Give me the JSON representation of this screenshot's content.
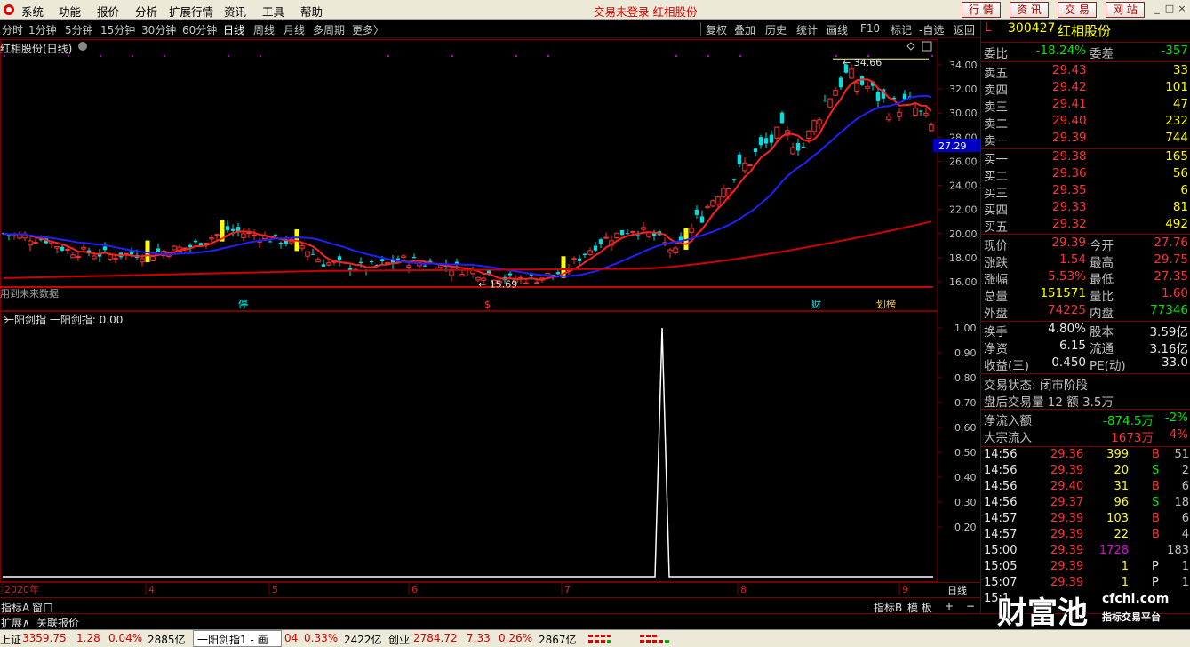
{
  "menubar": {
    "items": [
      "系统",
      "功能",
      "报价",
      "分析",
      "扩展行情",
      "资讯",
      "工具",
      "帮助"
    ],
    "status": "交易未登录  红相股份",
    "right_buttons": [
      "行 情",
      "资 讯",
      "交 易",
      "网 站"
    ]
  },
  "toolbar": {
    "periods": [
      "分时",
      "1分钟",
      "5分钟",
      "15分钟",
      "30分钟",
      "60分钟",
      "日线",
      "周线",
      "月线",
      "多周期",
      "更多〉"
    ],
    "active_period": "日线",
    "tools": [
      "复权",
      "叠加",
      "历史",
      "统计",
      "画线",
      "F10",
      "标记",
      "-自选",
      "返回"
    ]
  },
  "main_chart": {
    "title": "红相股份(日线)",
    "price_axis": [
      "34.00",
      "32.00",
      "30.00",
      "28.00",
      "26.00",
      "24.00",
      "22.00",
      "20.00",
      "18.00",
      "16.00"
    ],
    "current_price_label": "27.29",
    "high_label": "34.66",
    "low_label": "15.69",
    "left_note": "用到未来数据",
    "event_markers": [
      {
        "text": "停",
        "color": "#00ffff"
      },
      {
        "text": "$",
        "color": "#ff3232"
      },
      {
        "text": "财",
        "color": "#00ffff"
      },
      {
        "text": "划榜",
        "color": "#ffd060"
      }
    ]
  },
  "indicator": {
    "title": "一阳剑指  一阳剑指: 0.00",
    "axis": [
      "1.00",
      "0.90",
      "0.80",
      "0.70",
      "0.60",
      "0.50",
      "0.40",
      "0.30",
      "0.20"
    ]
  },
  "date_axis": {
    "labels": [
      "2020年",
      "4",
      "5",
      "6",
      "7",
      "8",
      "9"
    ],
    "period_label": "日线"
  },
  "bottom_tabs": {
    "left": [
      "指标A",
      "窗口"
    ],
    "left2": [
      "扩展∧",
      "关联报价"
    ],
    "right": [
      "指标B",
      "模 板",
      "+",
      "−"
    ]
  },
  "quote": {
    "code": "300427",
    "name": "红相股份",
    "flag": "L",
    "weibi_label": "委比",
    "weibi": "-18.24%",
    "weicha_label": "委差",
    "weicha": "-357",
    "asks": [
      {
        "label": "卖五",
        "price": "29.43",
        "vol": "33"
      },
      {
        "label": "卖四",
        "price": "29.42",
        "vol": "101"
      },
      {
        "label": "卖三",
        "price": "29.41",
        "vol": "47"
      },
      {
        "label": "卖二",
        "price": "29.40",
        "vol": "232"
      },
      {
        "label": "卖一",
        "price": "29.39",
        "vol": "744"
      }
    ],
    "bids": [
      {
        "label": "买一",
        "price": "29.38",
        "vol": "165"
      },
      {
        "label": "买二",
        "price": "29.36",
        "vol": "56"
      },
      {
        "label": "买三",
        "price": "29.35",
        "vol": "6"
      },
      {
        "label": "买四",
        "price": "29.33",
        "vol": "81"
      },
      {
        "label": "买五",
        "price": "29.32",
        "vol": "492"
      }
    ],
    "stats": [
      {
        "l1": "现价",
        "v1": "29.39",
        "c1": "red",
        "l2": "今开",
        "v2": "27.76",
        "c2": "red"
      },
      {
        "l1": "涨跌",
        "v1": "1.54",
        "c1": "red",
        "l2": "最高",
        "v2": "29.75",
        "c2": "red"
      },
      {
        "l1": "涨幅",
        "v1": "5.53%",
        "c1": "red",
        "l2": "最低",
        "v2": "27.35",
        "c2": "red"
      },
      {
        "l1": "总量",
        "v1": "151571",
        "c1": "yellow",
        "l2": "量比",
        "v2": "1.60",
        "c2": "red"
      },
      {
        "l1": "外盘",
        "v1": "74225",
        "c1": "red",
        "l2": "内盘",
        "v2": "77346",
        "c2": "green"
      }
    ],
    "stats2": [
      {
        "l1": "换手",
        "v1": "4.80%",
        "c1": "white",
        "l2": "股本",
        "v2": "3.59亿",
        "c2": "white"
      },
      {
        "l1": "净资",
        "v1": "6.15",
        "c1": "white",
        "l2": "流通",
        "v2": "3.16亿",
        "c2": "white"
      },
      {
        "l1": "收益(三)",
        "v1": "0.450",
        "c1": "white",
        "l2": "PE(动)",
        "v2": "33.0",
        "c2": "white"
      }
    ],
    "trade_status": "交易状态: 闭市阶段",
    "after_hours": "盘后交易量 12 额 3.5万",
    "flows": [
      {
        "label": "净流入额",
        "value": "-874.5万",
        "pct": "-2%",
        "color": "green"
      },
      {
        "label": "大宗流入",
        "value": "1673万",
        "pct": "4%",
        "color": "red"
      }
    ],
    "ticks": [
      {
        "time": "14:56",
        "price": "29.36",
        "vol": "399",
        "bs": "B",
        "n": "51"
      },
      {
        "time": "14:56",
        "price": "29.39",
        "vol": "20",
        "bs": "S",
        "n": "2"
      },
      {
        "time": "14:56",
        "price": "29.40",
        "vol": "31",
        "bs": "B",
        "n": "6"
      },
      {
        "time": "14:56",
        "price": "29.37",
        "vol": "96",
        "bs": "S",
        "n": "18"
      },
      {
        "time": "14:57",
        "price": "29.39",
        "vol": "103",
        "bs": "B",
        "n": "6"
      },
      {
        "time": "14:57",
        "price": "29.39",
        "vol": "22",
        "bs": "B",
        "n": "4"
      },
      {
        "time": "15:00",
        "price": "29.39",
        "vol": "1728",
        "bs": "",
        "n": "183"
      },
      {
        "time": "15:05",
        "price": "29.39",
        "vol": "1",
        "bs": "P",
        "n": "1"
      },
      {
        "time": "15:07",
        "price": "29.39",
        "vol": "1",
        "bs": "P",
        "n": "1"
      },
      {
        "time": "15:1",
        "price": "",
        "vol": "",
        "bs": "",
        "n": ""
      }
    ]
  },
  "index_bar": {
    "sh_label": "上证",
    "sh_value": "3359.75",
    "sh_change": "1.28",
    "sh_pct": "0.04%",
    "sh_amount": "2885亿",
    "tab": "一阳剑指1 - 画图",
    "mid_prefix": "04",
    "mid_pct": "0.33%",
    "mid_amount": "2422亿",
    "cy_label": "创业",
    "cy_value": "2784.72",
    "cy_change": "7.33",
    "cy_pct": "0.26%",
    "cy_amount": "2867亿"
  },
  "watermark": {
    "brand": "财富池",
    "site": "cfchi.com",
    "slogan": "指标交易平台"
  }
}
